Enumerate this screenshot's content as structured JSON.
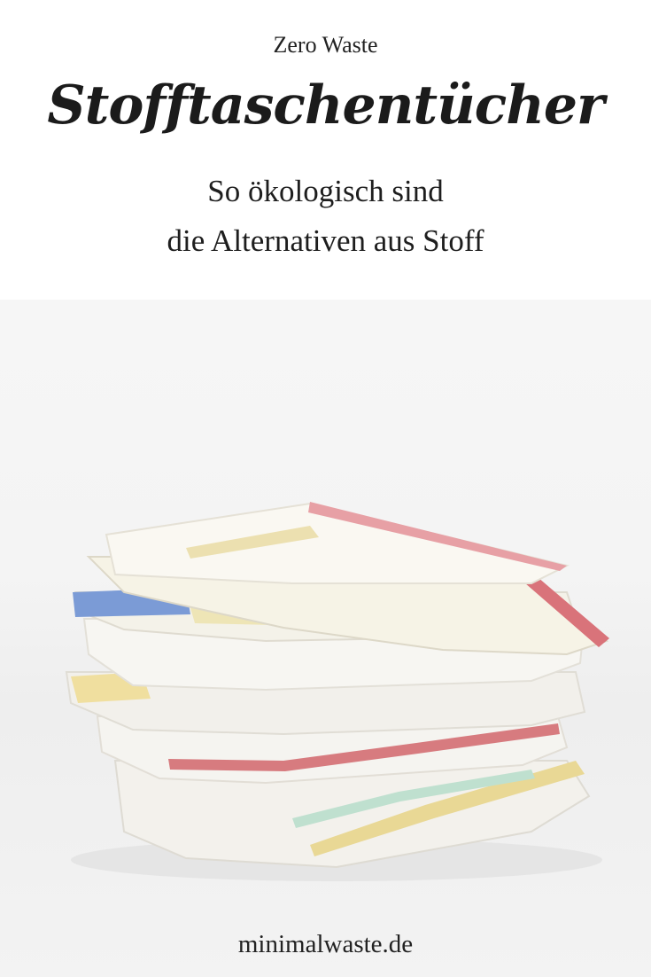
{
  "header": {
    "kicker": "Zero Waste",
    "title": "Stofftaschentücher",
    "subtitle_line1": "So ökologisch sind",
    "subtitle_line2": "die Alternativen aus Stoff"
  },
  "footer": {
    "site": "minimalwaste.de"
  },
  "colors": {
    "background": "#ffffff",
    "text": "#1e1e1e",
    "cloth_white": "#f1efea",
    "stripe_red": "#d9737a",
    "stripe_blue": "#6c8fd1",
    "stripe_yellow": "#e8d79a"
  }
}
